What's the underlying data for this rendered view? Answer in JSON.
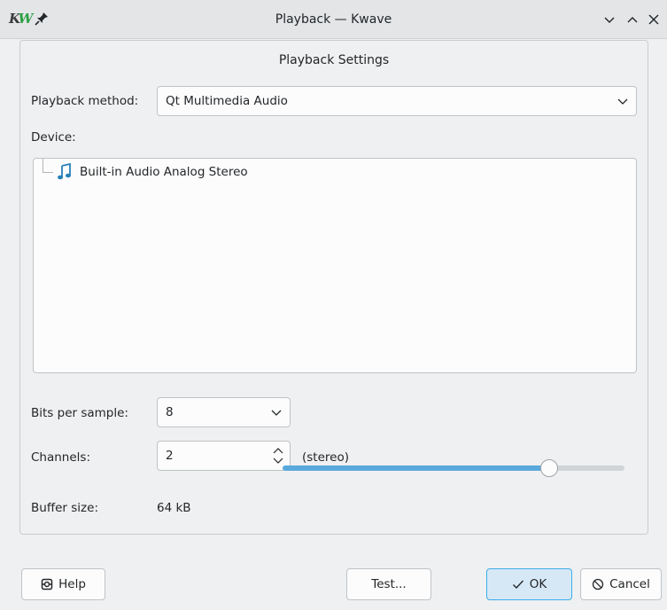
{
  "window": {
    "title": "Playback — Kwave",
    "app_icon_text": "KW",
    "icons": [
      "kwave-app-icon",
      "pin-icon",
      "minimize-icon",
      "maximize-icon",
      "close-icon"
    ]
  },
  "settings": {
    "section_title": "Playback Settings",
    "playback_method": {
      "label": "Playback method:",
      "value": "Qt Multimedia Audio"
    },
    "device": {
      "label": "Device:",
      "items": [
        {
          "label": "Built-in Audio Analog Stereo",
          "icon": "music-note-icon"
        }
      ]
    },
    "bits_per_sample": {
      "label": "Bits per sample:",
      "value": "8"
    },
    "channels": {
      "label": "Channels:",
      "value": "2",
      "description": "(stereo)"
    },
    "buffer_size": {
      "label": "Buffer size:",
      "value": "64 kB",
      "slider_fraction": 0.78
    }
  },
  "buttons": {
    "help": "Help",
    "test": "Test...",
    "ok": "OK",
    "cancel": "Cancel"
  },
  "colors": {
    "accent": "#3daee9",
    "slider_fill": "#5aa9dc",
    "note_icon": "#2980b9"
  }
}
